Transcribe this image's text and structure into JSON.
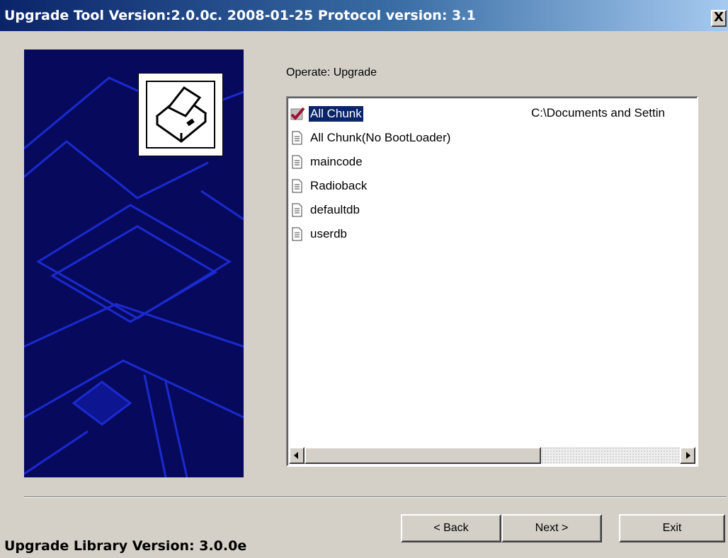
{
  "window": {
    "title": "Upgrade Tool Version:2.0.0c. 2008-01-25 Protocol version: 3.1",
    "close_label": "X"
  },
  "main": {
    "operate_label": "Operate: Upgrade",
    "list": {
      "items": [
        {
          "label": "All Chunk",
          "path": "C:\\Documents and Settin",
          "selected": true,
          "checked": true,
          "icon": "checkmark-icon"
        },
        {
          "label": "All Chunk(No BootLoader)",
          "path": "",
          "icon": "document-icon"
        },
        {
          "label": "maincode",
          "path": "",
          "icon": "document-icon"
        },
        {
          "label": "Radioback",
          "path": "",
          "icon": "document-icon"
        },
        {
          "label": "defaultdb",
          "path": "",
          "icon": "document-icon"
        },
        {
          "label": "userdb",
          "path": "",
          "icon": "document-icon"
        }
      ]
    }
  },
  "buttons": {
    "back": "< Back",
    "next": "Next >",
    "exit": "Exit"
  },
  "footer": {
    "library_version": "Upgrade Library Version: 3.0.0e"
  },
  "colors": {
    "title_bar": "#0a246a",
    "art_background": "#070a5c",
    "art_lines": "#1a2ad0",
    "selection": "#0a246a",
    "dialog_face": "#d4d0c8"
  }
}
